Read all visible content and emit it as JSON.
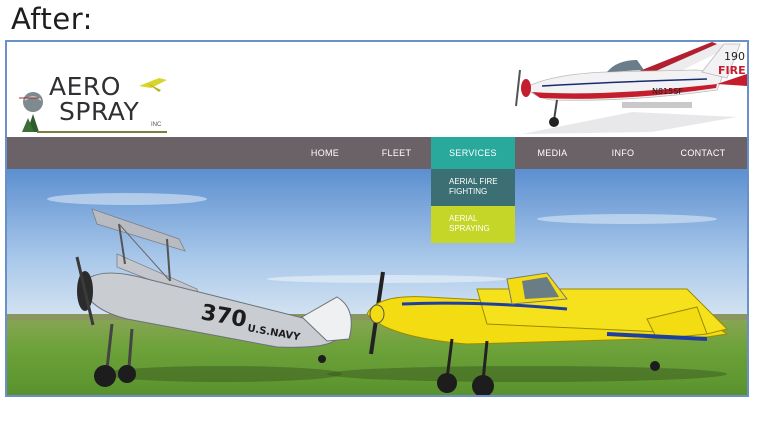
{
  "caption": "After:",
  "logo": {
    "line1": "AERO",
    "line2": "SPRAY",
    "inc": "INC"
  },
  "nav": {
    "items": [
      "HOME",
      "FLEET",
      "SERVICES",
      "MEDIA",
      "INFO",
      "CONTACT"
    ],
    "active": "SERVICES"
  },
  "dropdown": [
    "AERIAL FIRE FIGHTING",
    "AERIAL SPRAYING"
  ],
  "hero": {
    "biplane_number": "370",
    "biplane_marking": "U.S.NAVY"
  },
  "colors": {
    "nav": "#6b6268",
    "active": "#29a89c",
    "dropdown1": "#3c6f73",
    "dropdown2": "#c5d629"
  }
}
